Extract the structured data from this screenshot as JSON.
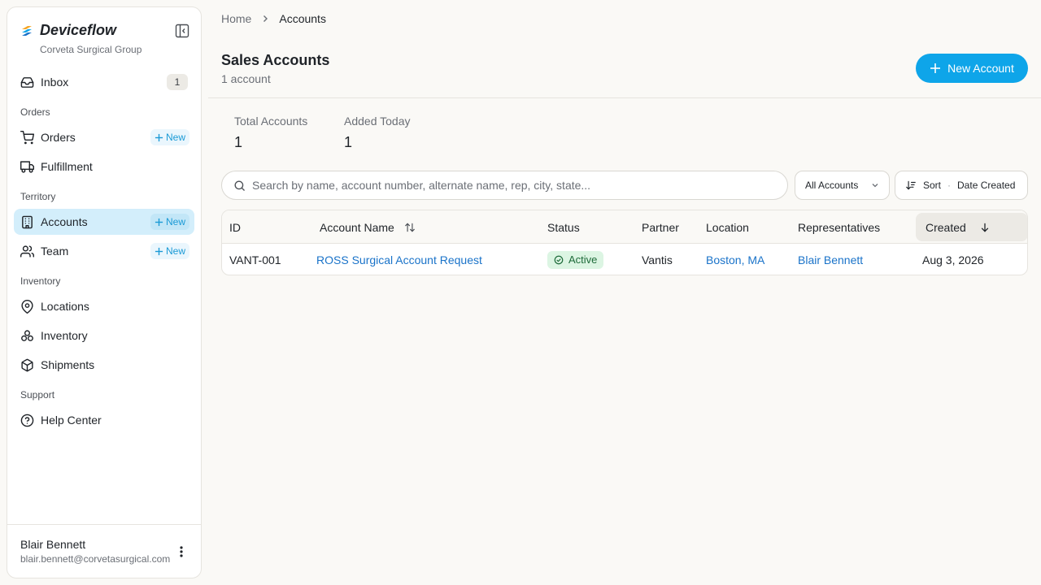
{
  "sidebar": {
    "brand_name": "Deviceflow",
    "org_name": "Corveta Surgical Group",
    "inbox": {
      "label": "Inbox",
      "count": "1"
    },
    "sections": {
      "orders": "Orders",
      "territory": "Territory",
      "inventory": "Inventory",
      "support": "Support"
    },
    "items": {
      "orders": "Orders",
      "fulfillment": "Fulfillment",
      "accounts": "Accounts",
      "team": "Team",
      "locations": "Locations",
      "inventory": "Inventory",
      "shipments": "Shipments",
      "help_center": "Help Center"
    },
    "new_label": "New",
    "active_item": "accounts",
    "user": {
      "name": "Blair Bennett",
      "email": "blair.bennett@corvetasurgical.com"
    }
  },
  "breadcrumb": {
    "home": "Home",
    "current": "Accounts"
  },
  "page": {
    "title": "Sales Accounts",
    "subtitle": "1 account",
    "new_button": "New Account"
  },
  "stats": [
    {
      "label": "Total Accounts",
      "value": "1"
    },
    {
      "label": "Added Today",
      "value": "1"
    }
  ],
  "search": {
    "placeholder": "Search by name, account number, alternate name, rep, city, state..."
  },
  "filter": {
    "selected": "All Accounts"
  },
  "sort": {
    "label": "Sort",
    "value": "Date Created"
  },
  "table": {
    "columns": [
      "ID",
      "Account Name",
      "Status",
      "Partner",
      "Location",
      "Representatives",
      "Created"
    ],
    "rows": [
      {
        "id": "VANT-001",
        "account_name": "ROSS Surgical Account Request",
        "status": "Active",
        "partner": "Vantis",
        "location": "Boston, MA",
        "representatives": "Blair Bennett",
        "created": "Aug 3, 2026"
      }
    ]
  },
  "colors": {
    "accent": "#0ea5e9",
    "active_nav": "#d3eefb",
    "link": "#1a73c9",
    "status_active_bg": "#dcf5e3",
    "status_active_text": "#1e6b3a"
  },
  "icons": {
    "inbox": "inbox-icon",
    "orders": "cart-icon",
    "fulfillment": "truck-icon",
    "accounts": "building-icon",
    "team": "users-icon",
    "locations": "map-pin-icon",
    "inventory": "boxes-icon",
    "shipments": "package-icon",
    "help_center": "help-circle-icon"
  }
}
